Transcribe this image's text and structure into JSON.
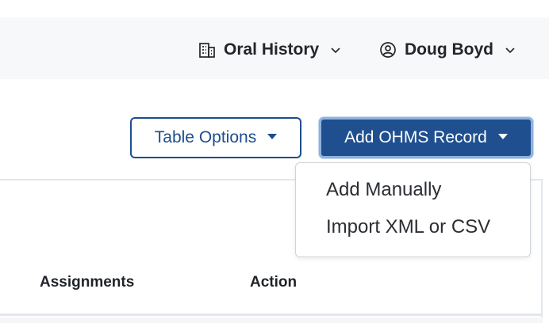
{
  "header": {
    "org": {
      "label": "Oral History",
      "icon": "building-icon"
    },
    "user": {
      "label": "Doug Boyd",
      "icon": "user-circle-icon"
    }
  },
  "toolbar": {
    "table_options_label": "Table Options",
    "add_record_label": "Add OHMS Record"
  },
  "add_record_menu": {
    "items": [
      {
        "label": "Add Manually"
      },
      {
        "label": "Import XML or CSV"
      }
    ]
  },
  "table": {
    "columns": [
      "Assignments",
      "Action"
    ]
  },
  "colors": {
    "primary": "#1f4f8f",
    "outline": "#1d4d8f",
    "header_bg": "#f7f8fa"
  }
}
